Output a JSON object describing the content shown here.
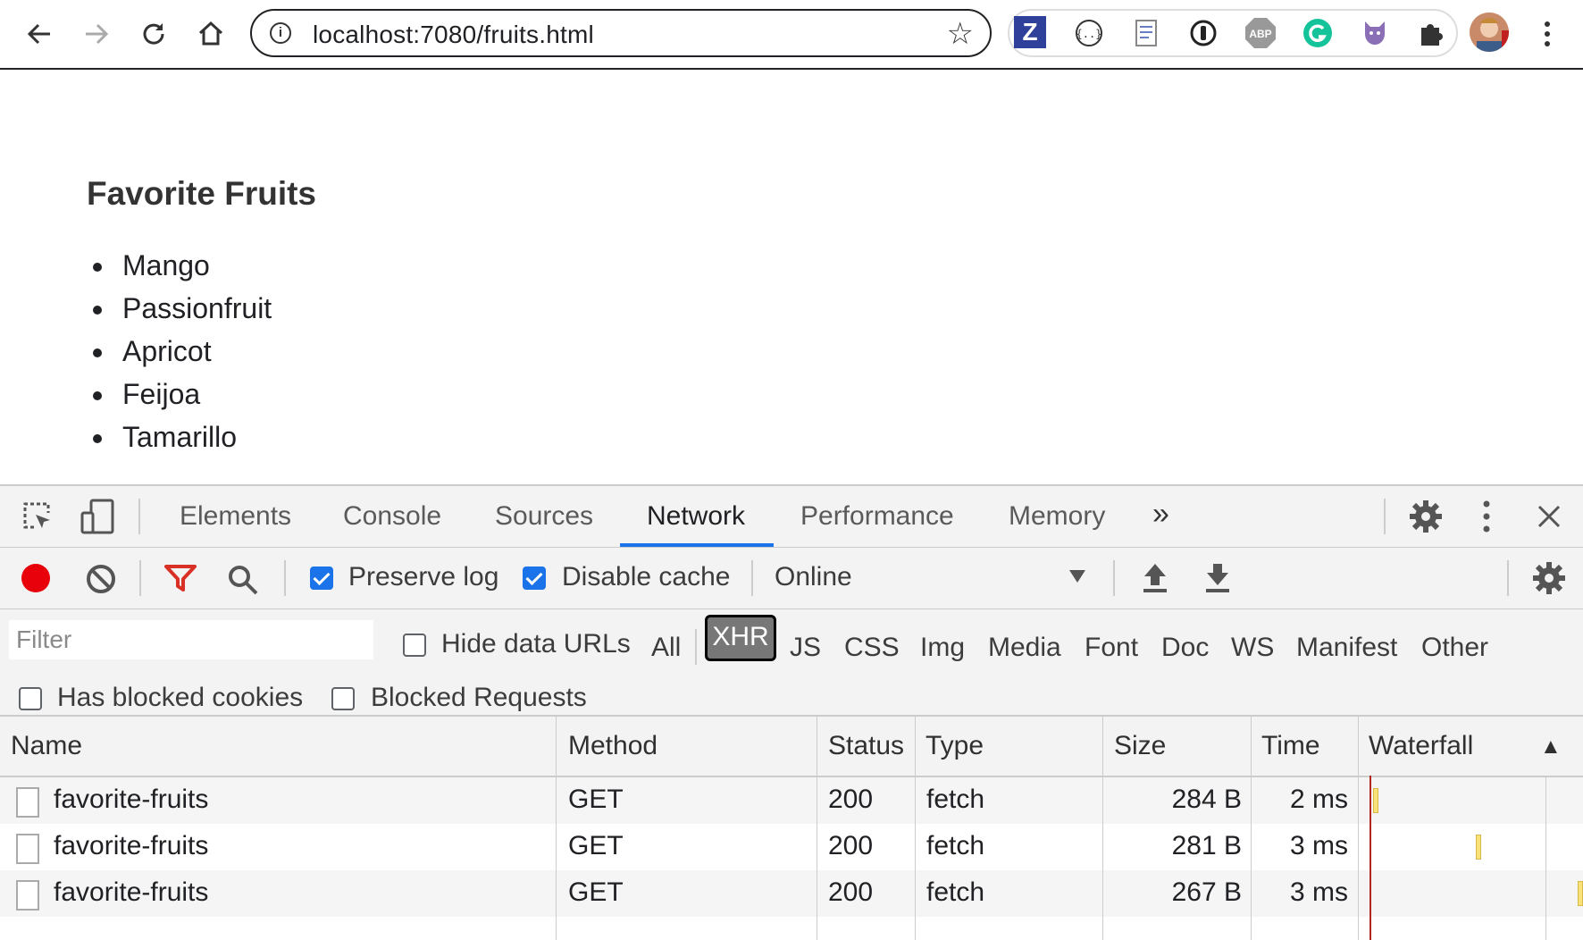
{
  "browser": {
    "url": "localhost:7080/fruits.html",
    "nav_icons": [
      "back-arrow-icon",
      "forward-arrow-icon",
      "reload-icon",
      "home-icon"
    ],
    "extensions": [
      "zotero-icon",
      "json-viewer-icon",
      "notes-icon",
      "password-manager-icon",
      "adblock-icon",
      "grammarly-icon",
      "github-cat-icon",
      "puzzle-extensions-icon"
    ],
    "ext_abp_label": "ABP",
    "ext_z_label": "Z"
  },
  "page": {
    "title": "Favorite Fruits",
    "fruits": [
      "Mango",
      "Passionfruit",
      "Apricot",
      "Feijoa",
      "Tamarillo"
    ]
  },
  "devtools": {
    "tabs": [
      "Elements",
      "Console",
      "Sources",
      "Network",
      "Performance",
      "Memory"
    ],
    "active_tab": "Network",
    "more_tabs": "»",
    "toolbar": {
      "preserve_log_label": "Preserve log",
      "preserve_log_checked": true,
      "disable_cache_label": "Disable cache",
      "disable_cache_checked": true,
      "throttling": "Online"
    },
    "filter": {
      "placeholder": "Filter",
      "hide_data_urls_label": "Hide data URLs",
      "types": [
        "All",
        "XHR",
        "JS",
        "CSS",
        "Img",
        "Media",
        "Font",
        "Doc",
        "WS",
        "Manifest",
        "Other"
      ],
      "active_type": "XHR",
      "has_blocked_cookies_label": "Has blocked cookies",
      "blocked_requests_label": "Blocked Requests"
    },
    "table": {
      "columns": [
        "Name",
        "Method",
        "Status",
        "Type",
        "Size",
        "Time",
        "Waterfall"
      ],
      "sort_indicator": "▲",
      "rows": [
        {
          "name": "favorite-fruits",
          "method": "GET",
          "status": "200",
          "type": "fetch",
          "size": "284 B",
          "time": "2 ms"
        },
        {
          "name": "favorite-fruits",
          "method": "GET",
          "status": "200",
          "type": "fetch",
          "size": "281 B",
          "time": "3 ms"
        },
        {
          "name": "favorite-fruits",
          "method": "GET",
          "status": "200",
          "type": "fetch",
          "size": "267 B",
          "time": "3 ms"
        }
      ]
    },
    "colors": {
      "record": "#e8000b",
      "filter_icon": "#d93025",
      "accent": "#1a73e8"
    }
  }
}
